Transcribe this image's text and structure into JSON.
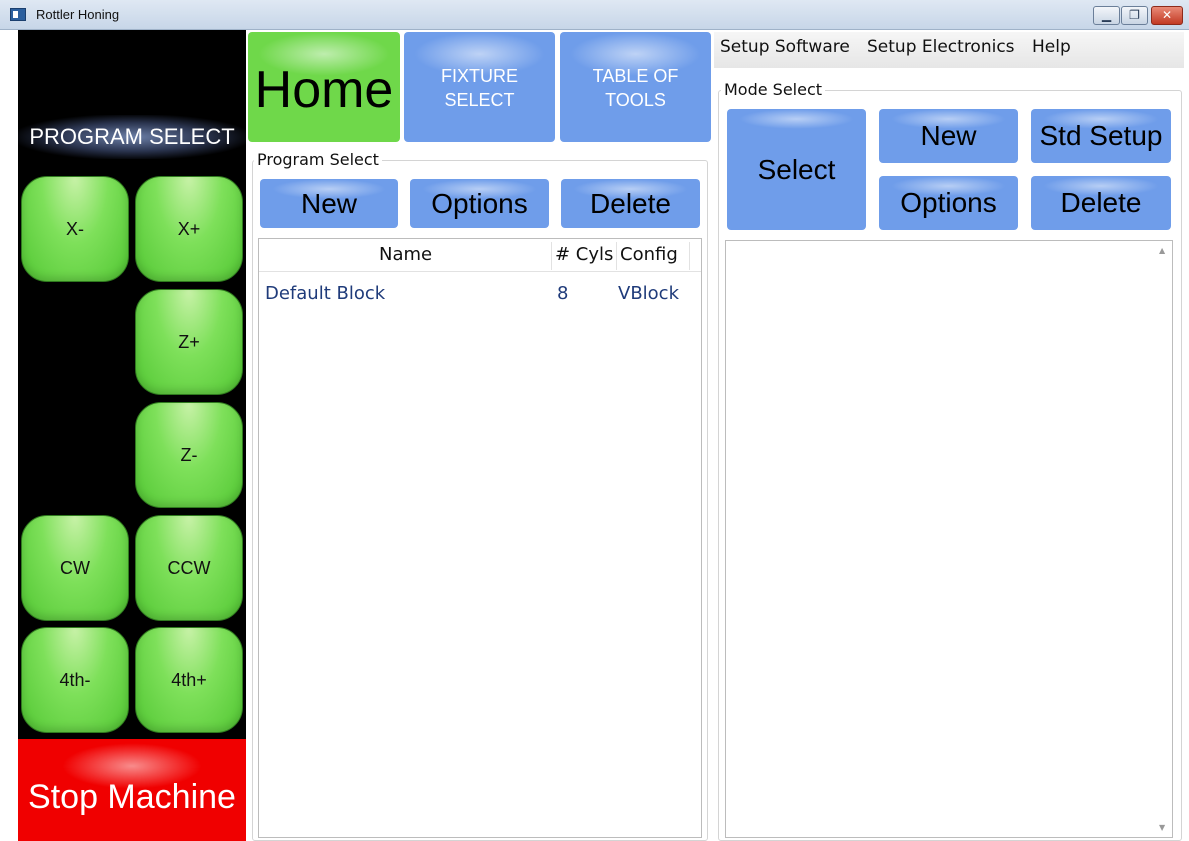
{
  "window": {
    "title": "Rottler Honing",
    "minimize_glyph": "▁",
    "maximize_glyph": "❐",
    "close_glyph": "✕"
  },
  "jog": {
    "heading": "PROGRAM SELECT",
    "x_minus": "X-",
    "x_plus": "X+",
    "z_plus": "Z+",
    "z_minus": "Z-",
    "cw": "CW",
    "ccw": "CCW",
    "fourth_minus": "4th-",
    "fourth_plus": "4th+",
    "stop": "Stop Machine"
  },
  "tabs": {
    "home": "Home",
    "fixture_line1": "FIXTURE",
    "fixture_line2": "SELECT",
    "tools_line1": "TABLE OF",
    "tools_line2": "TOOLS"
  },
  "menu": {
    "setup_software": "Setup Software",
    "setup_electronics": "Setup Electronics",
    "help": "Help"
  },
  "program_select": {
    "label": "Program Select",
    "new": "New",
    "options": "Options",
    "delete": "Delete",
    "columns": [
      "Name",
      "# Cyls",
      "Config"
    ],
    "rows": [
      {
        "name": "Default Block",
        "cyls": "8",
        "config": "VBlock"
      }
    ]
  },
  "mode_select": {
    "label": "Mode Select",
    "select": "Select",
    "new": "New",
    "std_setup": "Std Setup",
    "options": "Options",
    "delete": "Delete"
  },
  "colors": {
    "jog_green": "#6fd84a",
    "tab_blue": "#6f9dea",
    "stop_red": "#f00000",
    "panel_black": "#000000"
  }
}
